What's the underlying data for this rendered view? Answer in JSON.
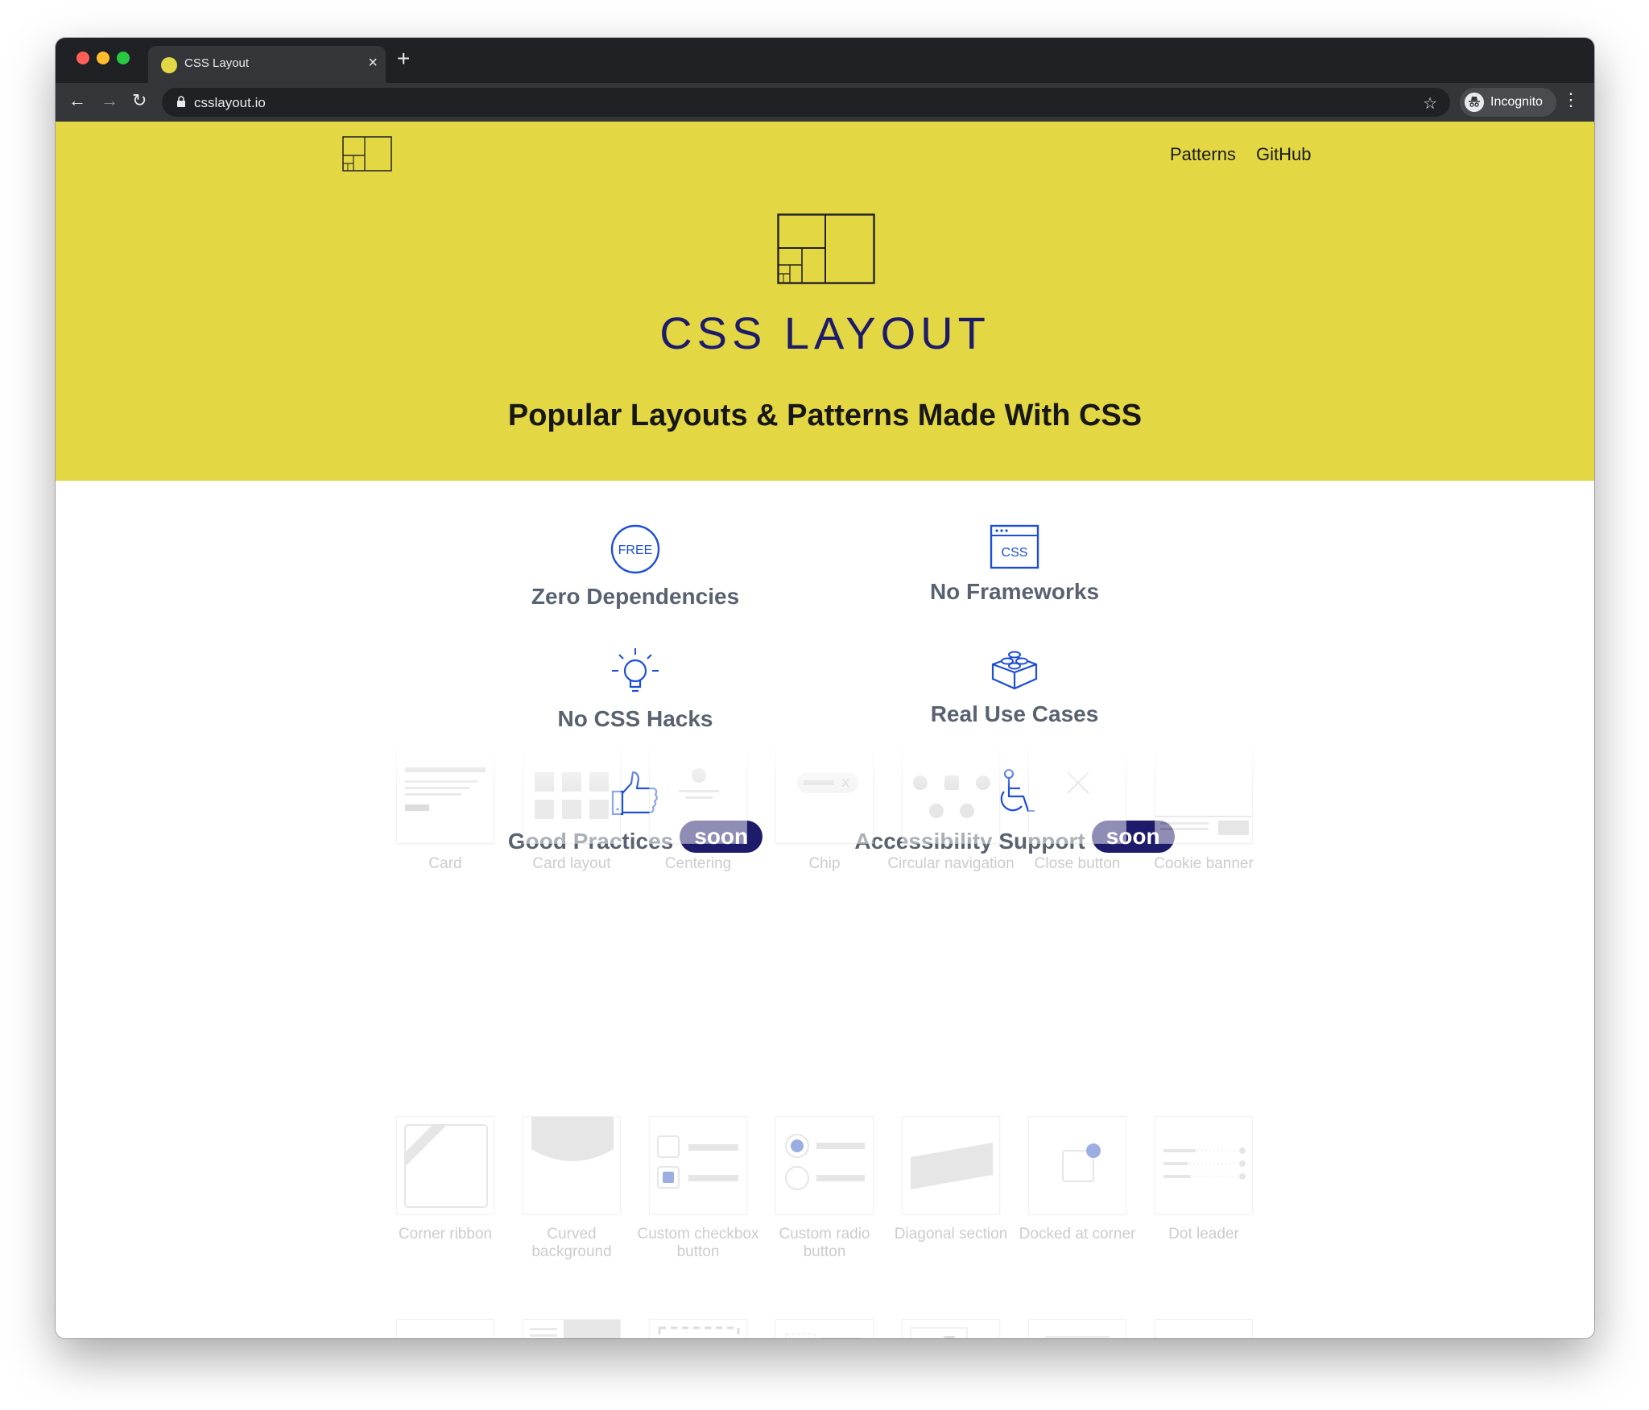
{
  "browser": {
    "tab_title": "CSS Layout",
    "url": "csslayout.io",
    "profile_label": "Incognito"
  },
  "site": {
    "nav_links": [
      "Patterns",
      "GitHub"
    ],
    "brand": "CSS LAYOUT",
    "tagline": "Popular Layouts & Patterns Made With CSS"
  },
  "features": [
    {
      "label": "Zero Dependencies",
      "icon": "free-badge-icon"
    },
    {
      "label": "No Frameworks",
      "icon": "css-window-icon"
    },
    {
      "label": "No CSS Hacks",
      "icon": "lightbulb-icon"
    },
    {
      "label": "Real Use Cases",
      "icon": "lego-brick-icon"
    },
    {
      "label": "Good Practices",
      "icon": "thumbs-up-icon",
      "badge": "soon"
    },
    {
      "label": "Accessibility Support",
      "icon": "wheelchair-icon",
      "badge": "soon"
    }
  ],
  "patterns": [
    [
      "Card",
      "Card layout",
      "Centering",
      "Chip",
      "Circular navigation",
      "Close button",
      "Cookie banner"
    ],
    [
      "Corner ribbon",
      "Curved background",
      "Custom checkbox button",
      "Custom radio button",
      "Diagonal section",
      "Docked at corner",
      "Dot leader"
    ]
  ],
  "colors": {
    "hero_bg": "#e3d744",
    "brand_navy": "#1e1b6b",
    "icon_blue": "#1d4ed8",
    "feature_text": "#596270",
    "chrome_dark": "#202124"
  }
}
